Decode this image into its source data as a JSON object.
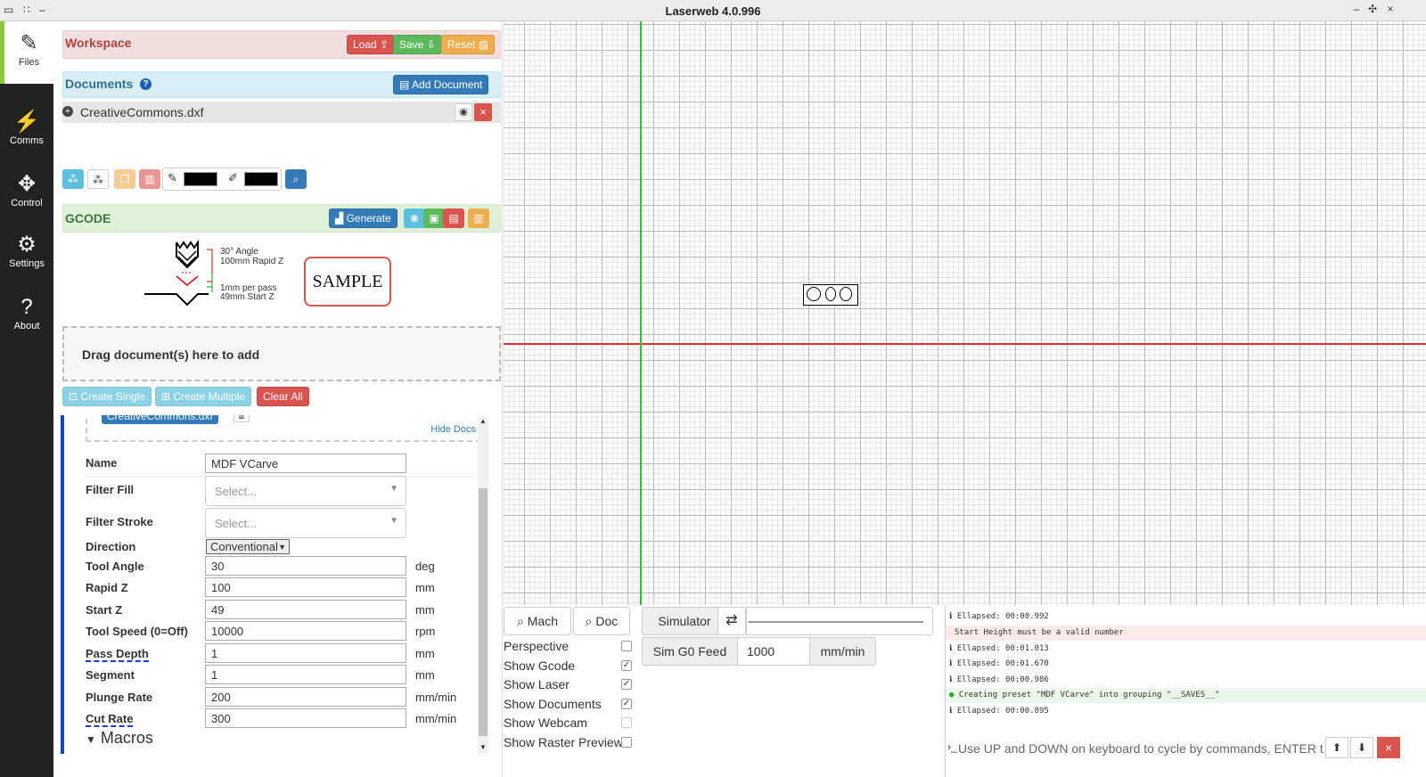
{
  "window": {
    "title": "Laserweb 4.0.996"
  },
  "sidebar": {
    "items": [
      {
        "label": "Files",
        "icon": "edit-icon"
      },
      {
        "label": "Comms",
        "icon": "plug-icon"
      },
      {
        "label": "Control",
        "icon": "arrows-icon"
      },
      {
        "label": "Settings",
        "icon": "gears-icon"
      },
      {
        "label": "About",
        "icon": "question-icon"
      }
    ]
  },
  "workspace": {
    "title": "Workspace",
    "load": "Load",
    "save": "Save",
    "reset": "Reset"
  },
  "documents": {
    "title": "Documents",
    "add": "Add Document",
    "items": [
      {
        "name": "CreativeCommons.dxf"
      }
    ]
  },
  "gcode": {
    "title": "GCODE",
    "generate": "Generate"
  },
  "diagram": {
    "angle": "30° Angle",
    "rapid": "100mm Rapid Z",
    "pass": "1mm per pass",
    "start": "49mm Start Z",
    "sample": "SAMPLE"
  },
  "dropzone": {
    "text": "Drag document(s) here to add"
  },
  "ops": {
    "create_single": "Create Single",
    "create_multiple": "Create Multiple",
    "clear_all": "Clear All",
    "doc_tag": "CreativeCommons.dxf",
    "hide_docs": "Hide Docs"
  },
  "form": {
    "name": {
      "label": "Name",
      "value": "MDF VCarve"
    },
    "filter_fill": {
      "label": "Filter Fill",
      "placeholder": "Select..."
    },
    "filter_stroke": {
      "label": "Filter Stroke",
      "placeholder": "Select..."
    },
    "direction": {
      "label": "Direction",
      "value": "Conventional"
    },
    "tool_angle": {
      "label": "Tool Angle",
      "value": "30",
      "unit": "deg"
    },
    "rapid_z": {
      "label": "Rapid Z",
      "value": "100",
      "unit": "mm"
    },
    "start_z": {
      "label": "Start Z",
      "value": "49",
      "unit": "mm"
    },
    "tool_speed": {
      "label": "Tool Speed (0=Off)",
      "value": "10000",
      "unit": "rpm"
    },
    "pass_depth": {
      "label": "Pass Depth",
      "value": "1",
      "unit": "mm"
    },
    "segment": {
      "label": "Segment",
      "value": "1",
      "unit": "mm"
    },
    "plunge_rate": {
      "label": "Plunge Rate",
      "value": "200",
      "unit": "mm/min"
    },
    "cut_rate": {
      "label": "Cut Rate",
      "value": "300",
      "unit": "mm/min"
    },
    "macros": "Macros"
  },
  "viewer": {
    "mach": "Mach",
    "doc": "Doc",
    "simulator": "Simulator",
    "sim_feed_label": "Sim G0 Feed",
    "sim_feed_value": "1000",
    "sim_feed_unit": "mm/min",
    "options": [
      {
        "label": "Perspective",
        "checked": false
      },
      {
        "label": "Show Gcode",
        "checked": true
      },
      {
        "label": "Show Laser",
        "checked": true
      },
      {
        "label": "Show Documents",
        "checked": true
      },
      {
        "label": "Show Webcam",
        "checked": false
      },
      {
        "label": "Show Raster Preview",
        "checked": false
      }
    ]
  },
  "console": {
    "logs": [
      {
        "type": "info",
        "text": "Ellapsed: 00:00.992"
      },
      {
        "type": "error",
        "text": "Start Height must be a valid number"
      },
      {
        "type": "info",
        "text": "Ellapsed: 00:01.013"
      },
      {
        "type": "info",
        "text": "Ellapsed: 00:01.670"
      },
      {
        "type": "info",
        "text": "Ellapsed: 00:00.986"
      },
      {
        "type": "success",
        "text": "Creating preset \"MDF VCarve\" into grouping \"__SAVES__\""
      },
      {
        "type": "info",
        "text": "Ellapsed: 00:00.895"
      }
    ],
    "placeholder": "Use UP and DOWN on keyboard to cycle by commands, ENTER to"
  },
  "colors": {
    "sidebar": "#222222",
    "accent": "#8dc63f",
    "workspace_bg": "#f2dede",
    "documents_bg": "#d9edf7",
    "gcode_bg": "#dff0d8",
    "grid_red": "#e03030",
    "grid_green": "#30c030"
  }
}
